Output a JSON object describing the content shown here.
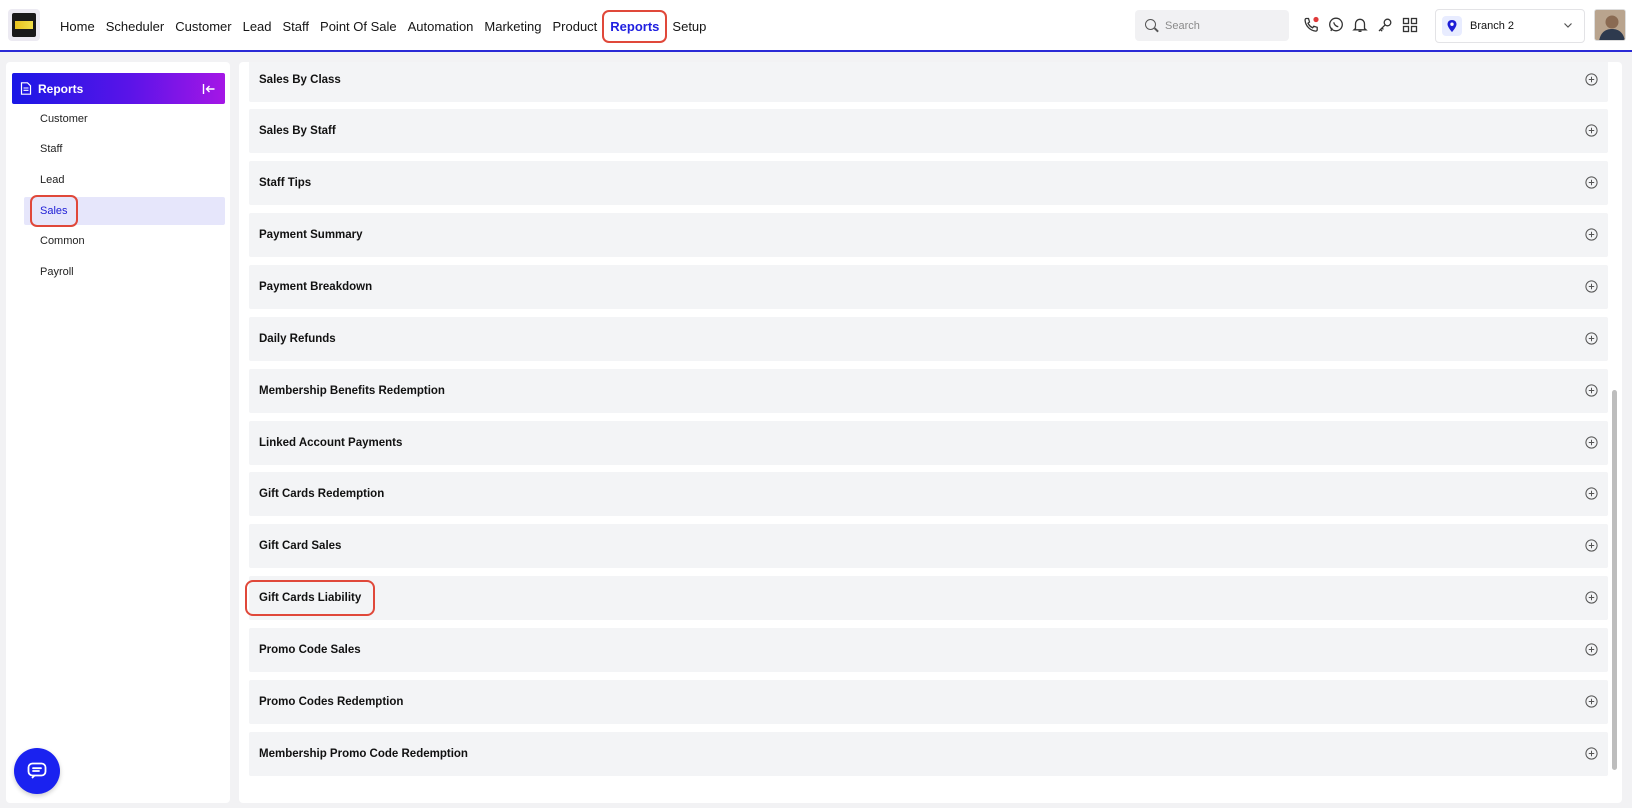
{
  "nav": {
    "items": [
      "Home",
      "Scheduler",
      "Customer",
      "Lead",
      "Staff",
      "Point Of Sale",
      "Automation",
      "Marketing",
      "Product",
      "Reports",
      "Setup"
    ],
    "active": "Reports"
  },
  "search": {
    "placeholder": "Search"
  },
  "branch": {
    "label": "Branch 2"
  },
  "sidebar": {
    "title": "Reports",
    "items": [
      "Customer",
      "Staff",
      "Lead",
      "Sales",
      "Common",
      "Payroll"
    ],
    "active": "Sales"
  },
  "reports": {
    "items": [
      "Sales By Class",
      "Sales By Staff",
      "Staff Tips",
      "Payment Summary",
      "Payment Breakdown",
      "Daily Refunds",
      "Membership Benefits Redemption",
      "Linked Account Payments",
      "Gift Cards Redemption",
      "Gift Card Sales",
      "Gift Cards Liability",
      "Promo Code Sales",
      "Promo Codes Redemption",
      "Membership Promo Code Redemption"
    ],
    "highlighted": "Gift Cards Liability"
  },
  "colors": {
    "accent": "#2020e0",
    "highlight_outline": "#e0483a",
    "sidebar_active_bg": "#e6e6fb"
  }
}
